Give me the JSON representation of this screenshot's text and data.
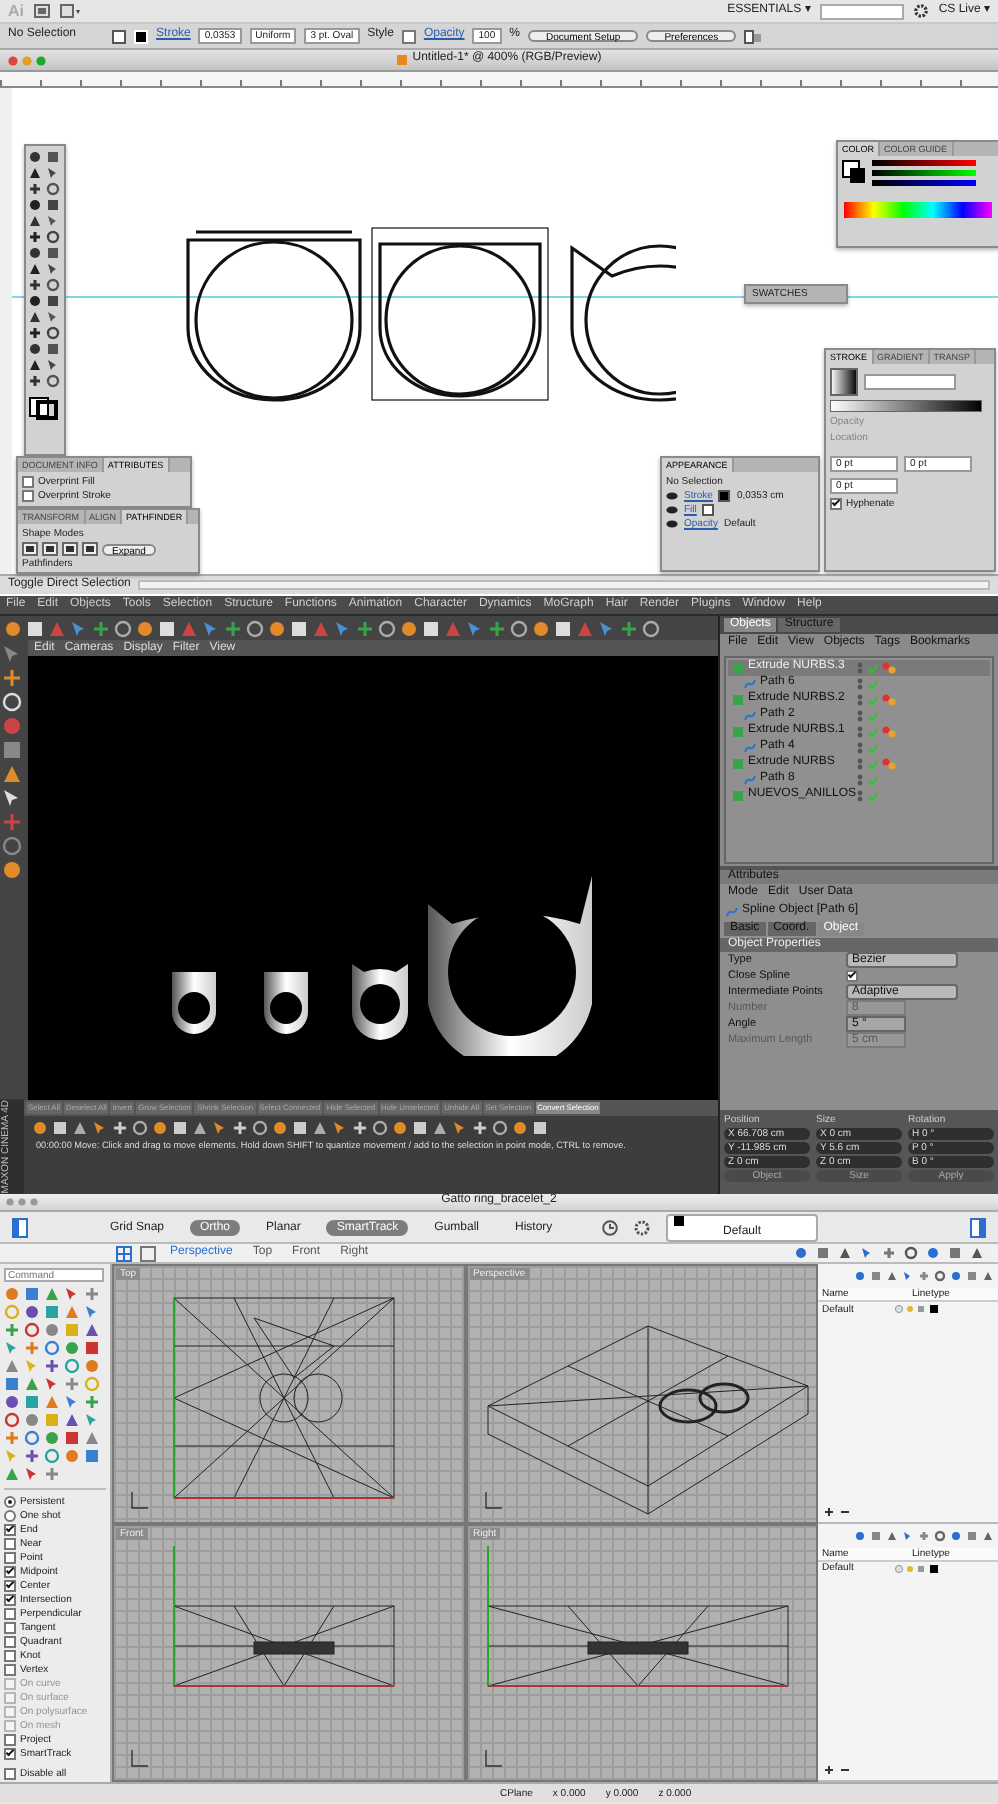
{
  "illustrator": {
    "app_bar": {
      "logo": "Ai",
      "workspace": "ESSENTIALS ▾",
      "account": "CS Live ▾"
    },
    "control_bar": {
      "selection": "No Selection",
      "stroke_label": "Stroke",
      "stroke_weight": "0,0353",
      "brush": "Uniform",
      "profile": "3 pt. Oval",
      "style_label": "Style",
      "opacity_label": "Opacity",
      "opacity": "100",
      "opacity_unit": "%",
      "buttons": [
        "Document Setup",
        "Preferences"
      ]
    },
    "document_title": "Untitled-1* @ 400% (RGB/Preview)",
    "color_panel": {
      "tabs": [
        {
          "label": "COLOR",
          "selected": true
        },
        {
          "label": "COLOR GUIDE",
          "selected": false
        }
      ]
    },
    "swatches_panel": {
      "title": "SWATCHES"
    },
    "stroke_panel": {
      "tabs": [
        {
          "label": "STROKE",
          "selected": true
        },
        {
          "label": "GRADIENT",
          "selected": false
        },
        {
          "label": "TRANSP",
          "selected": false
        }
      ],
      "labels": [
        "Opacity",
        "Location"
      ],
      "fields": [
        "0 pt",
        "0 pt",
        "0 pt"
      ],
      "checkbox": {
        "label": "Hyphenate",
        "checked": true
      }
    },
    "appearance_panel": {
      "title": "APPEARANCE",
      "selection": "No Selection",
      "rows": [
        {
          "label": "Stroke",
          "value": "0,0353 cm"
        },
        {
          "label": "Fill"
        },
        {
          "label": "Opacity",
          "value": "Default"
        }
      ]
    },
    "document_info_panel": {
      "tabs": [
        {
          "label": "DOCUMENT INFO",
          "selected": false
        },
        {
          "label": "ATTRIBUTES",
          "selected": true
        }
      ],
      "checkboxes": [
        {
          "label": "Overprint Fill",
          "checked": false
        },
        {
          "label": "Overprint Stroke",
          "checked": false
        }
      ]
    },
    "pathfinder_panel": {
      "tabs": [
        {
          "label": "TRANSFORM",
          "selected": false
        },
        {
          "label": "ALIGN",
          "selected": false
        },
        {
          "label": "PATHFINDER",
          "selected": true
        }
      ],
      "shape_modes": "Shape Modes",
      "expand": "Expand",
      "pathfinders": "Pathfinders"
    },
    "status": "Toggle Direct Selection"
  },
  "cinema4d": {
    "menu": [
      "File",
      "Edit",
      "Objects",
      "Tools",
      "Selection",
      "Structure",
      "Functions",
      "Animation",
      "Character",
      "Dynamics",
      "MoGraph",
      "Hair",
      "Render",
      "Plugins",
      "Window",
      "Help"
    ],
    "viewport_menu": [
      "Edit",
      "Cameras",
      "Display",
      "Filter",
      "View"
    ],
    "object_manager": {
      "tabs": [
        {
          "label": "Objects",
          "selected": true
        },
        {
          "label": "Structure",
          "selected": false
        }
      ],
      "menu": [
        "File",
        "Edit",
        "View",
        "Objects",
        "Tags",
        "Bookmarks"
      ],
      "objects": [
        {
          "name": "Extrude NURBS.3",
          "selected": true,
          "children": [
            {
              "name": "Path 6",
              "selected": false
            }
          ]
        },
        {
          "name": "Extrude NURBS.2",
          "selected": false,
          "children": [
            {
              "name": "Path 2",
              "selected": false
            }
          ]
        },
        {
          "name": "Extrude NURBS.1",
          "selected": false,
          "children": [
            {
              "name": "Path 4",
              "selected": false
            }
          ]
        },
        {
          "name": "Extrude NURBS",
          "selected": false,
          "children": [
            {
              "name": "Path 8",
              "selected": false
            }
          ]
        },
        {
          "name": "NUEVOS_ANILLOS",
          "selected": false
        }
      ]
    },
    "attributes": {
      "title": "Attributes",
      "menu": [
        "Mode",
        "Edit",
        "User Data"
      ],
      "object": "Spline Object [Path 6]",
      "tabs": [
        {
          "label": "Basic",
          "selected": false
        },
        {
          "label": "Coord.",
          "selected": false
        },
        {
          "label": "Object",
          "selected": true
        }
      ],
      "section": "Object Properties",
      "properties": [
        {
          "label": "Type",
          "kind": "dropdown",
          "value": "Bezier",
          "disabled": false
        },
        {
          "label": "Close Spline",
          "kind": "checkbox",
          "checked": true,
          "disabled": false
        },
        {
          "label": "Intermediate Points",
          "kind": "dropdown",
          "value": "Adaptive",
          "disabled": false
        },
        {
          "label": "Number",
          "kind": "field",
          "value": "8",
          "disabled": true
        },
        {
          "label": "Angle",
          "kind": "field",
          "value": "5 °",
          "disabled": false
        },
        {
          "label": "Maximum Length",
          "kind": "field",
          "value": "5 cm",
          "disabled": true
        }
      ]
    },
    "selection_bar": [
      "Select All",
      "Deselect All",
      "Invert",
      "Grow Selection",
      "Shrink Selection",
      "Select Connected",
      "Hide Selected",
      "Hide Unselected",
      "Unhide All",
      "Set Selection",
      "Convert Selection"
    ],
    "status": "00:00:00  Move: Click and drag to move elements. Hold down SHIFT to quantize movement / add to the selection in point mode, CTRL to remove.",
    "brand": "MAXON CINEMA 4D",
    "coordinates": {
      "headers": [
        "Position",
        "Size",
        "Rotation"
      ],
      "rows": [
        {
          "axis": "X",
          "position": "66.708 cm",
          "size_axis": "X",
          "size": "0 cm",
          "rotation_axis": "H",
          "rotation": "0 °"
        },
        {
          "axis": "Y",
          "position": "-11.985 cm",
          "size_axis": "Y",
          "size": "5.6 cm",
          "rotation_axis": "P",
          "rotation": "0 °"
        },
        {
          "axis": "Z",
          "position": "0 cm",
          "size_axis": "Z",
          "size": "0 cm",
          "rotation_axis": "B",
          "rotation": "0 °"
        }
      ],
      "dropdowns": [
        "Object",
        "Size"
      ],
      "apply": "Apply"
    }
  },
  "rhino": {
    "title": "Gatto ring_bracelet_2",
    "toolbar": [
      {
        "label": "Grid Snap",
        "on": false
      },
      {
        "label": "Ortho",
        "on": true
      },
      {
        "label": "Planar",
        "on": false
      },
      {
        "label": "SmartTrack",
        "on": true
      },
      {
        "label": "Gumball",
        "on": false
      },
      {
        "label": "History",
        "on": false
      }
    ],
    "layer": "Default",
    "viewport_tabs": [
      {
        "label": "Perspective",
        "selected": true
      },
      {
        "label": "Top",
        "selected": false
      },
      {
        "label": "Front",
        "selected": false
      },
      {
        "label": "Right",
        "selected": false
      }
    ],
    "command": {
      "placeholder": "Command"
    },
    "viewports": [
      "Top",
      "Perspective",
      "Front",
      "Right"
    ],
    "osnaps": [
      {
        "label": "Persistent",
        "kind": "radio",
        "checked": true,
        "disabled": false
      },
      {
        "label": "One shot",
        "kind": "radio",
        "checked": false,
        "disabled": false
      },
      {
        "label": "End",
        "kind": "check",
        "checked": true,
        "disabled": false
      },
      {
        "label": "Near",
        "kind": "check",
        "checked": false,
        "disabled": false
      },
      {
        "label": "Point",
        "kind": "check",
        "checked": false,
        "disabled": false
      },
      {
        "label": "Midpoint",
        "kind": "check",
        "checked": true,
        "disabled": false
      },
      {
        "label": "Center",
        "kind": "check",
        "checked": true,
        "disabled": false
      },
      {
        "label": "Intersection",
        "kind": "check",
        "checked": true,
        "disabled": false
      },
      {
        "label": "Perpendicular",
        "kind": "check",
        "checked": false,
        "disabled": false
      },
      {
        "label": "Tangent",
        "kind": "check",
        "checked": false,
        "disabled": false
      },
      {
        "label": "Quadrant",
        "kind": "check",
        "checked": false,
        "disabled": false
      },
      {
        "label": "Knot",
        "kind": "check",
        "checked": false,
        "disabled": false
      },
      {
        "label": "Vertex",
        "kind": "check",
        "checked": false,
        "disabled": false
      },
      {
        "label": "On curve",
        "kind": "check",
        "checked": false,
        "disabled": true
      },
      {
        "label": "On surface",
        "kind": "check",
        "checked": false,
        "disabled": true
      },
      {
        "label": "On polysurface",
        "kind": "check",
        "checked": false,
        "disabled": true
      },
      {
        "label": "On mesh",
        "kind": "check",
        "checked": false,
        "disabled": true
      },
      {
        "label": "Project",
        "kind": "check",
        "checked": false,
        "disabled": false
      },
      {
        "label": "SmartTrack",
        "kind": "check",
        "checked": true,
        "disabled": false
      }
    ],
    "disable_all": {
      "label": "Disable all",
      "checked": false
    },
    "layer_panels": [
      {
        "columns": [
          "Name",
          "Linetype"
        ],
        "rows": [
          "Default"
        ]
      },
      {
        "columns": [
          "Name",
          "Linetype"
        ],
        "rows": [
          "Default"
        ]
      }
    ],
    "status_bar": [
      "CPlane",
      "x 0.000",
      "y 0.000",
      "z 0.000"
    ]
  }
}
